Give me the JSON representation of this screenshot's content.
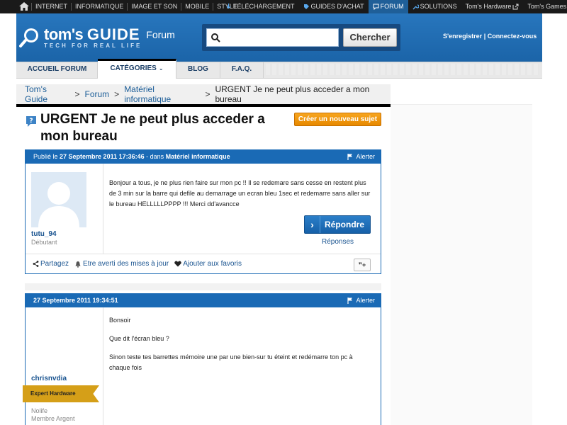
{
  "topbar": {
    "left_items": [
      "INTERNET",
      "INFORMATIQUE",
      "IMAGE ET SON",
      "MOBILE",
      "STYLE"
    ],
    "right_items": [
      {
        "label": "TÉLÉCHARGEMENT",
        "icon": "download-icon",
        "active": false
      },
      {
        "label": "GUIDES D'ACHAT",
        "icon": "tag-icon",
        "active": false
      },
      {
        "label": "FORUM",
        "icon": "chat-icon",
        "active": true
      },
      {
        "label": "SOLUTIONS",
        "icon": "wrench-icon",
        "active": false
      },
      {
        "label": "Tom's Hardware",
        "icon": "external-link-icon",
        "active": false
      },
      {
        "label": "Tom's Games",
        "icon": "external-link-icon",
        "active": false
      }
    ]
  },
  "header": {
    "brand_prefix": "tom's ",
    "brand_bold": "GUIDE",
    "tagline": "TECH FOR REAL LIFE",
    "section": "Forum",
    "search_placeholder": "",
    "search_button": "Chercher",
    "register": "S'enregistrer",
    "login": "Connectez-vous",
    "separator": "|"
  },
  "nav": {
    "items": [
      {
        "label": "ACCUEIL FORUM",
        "active": false
      },
      {
        "label": "CATÉGORIES",
        "active": true,
        "dropdown": true
      },
      {
        "label": "BLOG",
        "active": false
      },
      {
        "label": "F.A.Q.",
        "active": false
      }
    ]
  },
  "breadcrumb": {
    "items": [
      "Tom's Guide",
      "Forum",
      "Matériel informatique"
    ],
    "current": "URGENT Je ne peut plus acceder a mon bureau",
    "separator": ">"
  },
  "topic": {
    "title": "URGENT Je ne peut plus acceder a mon bureau",
    "new_topic_button": "Créer un nouveau sujet"
  },
  "post1": {
    "published_prefix": "Publié le ",
    "date": "27 Septembre 2011 17:36:46",
    "in_prefix": " - dans ",
    "category": "Matériel informatique",
    "alert": "Alerter",
    "username": "tutu_94",
    "rank": "Débutant",
    "body": "Bonjour a tous, je ne plus rien faire sur mon pc !! Il se redemare sans cesse en restent plus de 3 min sur la barre qui defile au demarrage un ecran bleu 1sec et redemarre sans aller sur le bureau HELLLLLPPPP !!! Merci dd'avancce",
    "reply_button": "Répondre",
    "replies_link": "Réponses",
    "actions": {
      "share": "Partagez",
      "notify": "Etre averti des mises à jour",
      "favorite": "Ajouter aux favoris",
      "quote": "❞+"
    }
  },
  "post2": {
    "date": "27 Septembre 2011 19:34:51",
    "alert": "Alerter",
    "username": "chrisnvdia",
    "badge": "Expert Hardware",
    "rank1": "Nolife",
    "rank2": "Membre Argent",
    "paragraphs": [
      "Bonsoir",
      "Que dit l'écran bleu ?",
      "Sinon teste tes barrettes mémoire une par une bien-sur tu éteint et redémarre ton pc à chaque fois"
    ]
  },
  "colors": {
    "header_blue": "#1f6eb5",
    "post_blue": "#1a6ab5",
    "orange_button": "#f0961a",
    "badge_gold": "#d59f18"
  }
}
